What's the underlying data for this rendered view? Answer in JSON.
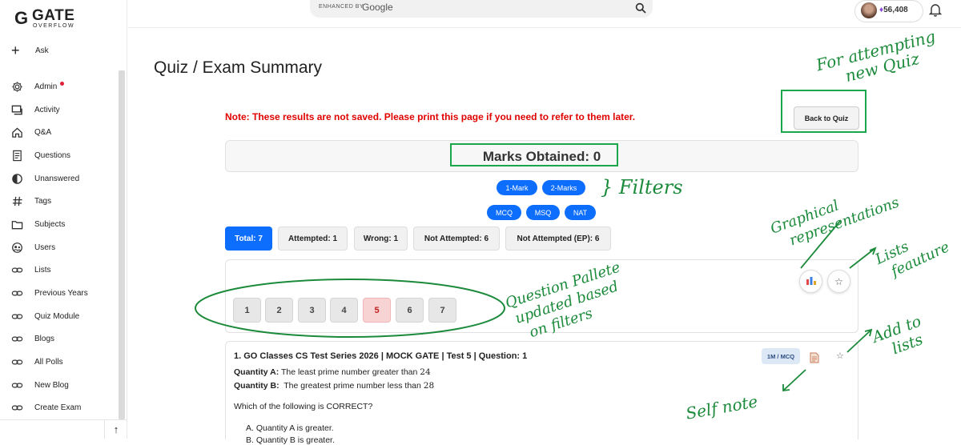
{
  "sidebar": {
    "logo_gate": "GATE",
    "logo_sub": "OVERFLOW",
    "ask_label": "Ask",
    "items": [
      {
        "label": "Admin",
        "icon": "gear-icon"
      },
      {
        "label": "Activity",
        "icon": "chat-icon"
      },
      {
        "label": "Q&A",
        "icon": "home-icon"
      },
      {
        "label": "Questions",
        "icon": "document-icon"
      },
      {
        "label": "Unanswered",
        "icon": "half-circle-icon"
      },
      {
        "label": "Tags",
        "icon": "hash-icon"
      },
      {
        "label": "Subjects",
        "icon": "folder-icon"
      },
      {
        "label": "Users",
        "icon": "users-icon"
      },
      {
        "label": "Lists",
        "icon": "link-icon"
      },
      {
        "label": "Previous Years",
        "icon": "link-icon"
      },
      {
        "label": "Quiz Module",
        "icon": "link-icon"
      },
      {
        "label": "Blogs",
        "icon": "link-icon"
      },
      {
        "label": "All Polls",
        "icon": "link-icon"
      },
      {
        "label": "New Blog",
        "icon": "link-icon"
      },
      {
        "label": "Create Exam",
        "icon": "link-icon"
      }
    ]
  },
  "header": {
    "search_enhanced": "ENHANCED BY",
    "search_google": "Google",
    "points": "56,408"
  },
  "main": {
    "title": "Quiz / Exam Summary",
    "note": "Note: These results are not saved. Please print this page if you need to refer to them later.",
    "back_button": "Back to Quiz",
    "marks": "Marks Obtained: 0",
    "filters_row1": [
      "1-Mark",
      "2-Marks"
    ],
    "filters_row2": [
      "MCQ",
      "MSQ",
      "NAT"
    ],
    "tabs": [
      "Total: 7",
      "Attempted: 1",
      "Wrong: 1",
      "Not Attempted: 6",
      "Not Attempted (EP): 6"
    ],
    "palette": [
      "1",
      "2",
      "3",
      "4",
      "5",
      "6",
      "7"
    ],
    "wrong_question": "5"
  },
  "question": {
    "title": "1. GO Classes CS Test Series 2026 | MOCK GATE | Test 5 | Question: 1",
    "badge": "1M / MCQ",
    "qa_label": "Quantity A:",
    "qa_text": "The least prime number greater than",
    "qa_value": "24",
    "qb_label": "Quantity B:",
    "qb_text": "The greatest prime number less than",
    "qb_value": "28",
    "prompt": "Which of the following is CORRECT?",
    "option_a": "A. Quantity A is greater.",
    "option_b": "B. Quantity B is greater."
  },
  "annotations": {
    "quiz_line1": "For attempting",
    "quiz_line2": "new Quiz",
    "filters": "Filters",
    "graph_line1": "Graphical",
    "graph_line2": "representations",
    "lists_line1": "Lists",
    "lists_line2": "feauture",
    "palette_line1": "Question Pallete",
    "palette_line2": "updated based",
    "palette_line3": "on filters",
    "add_line1": "Add to",
    "add_line2": "lists",
    "self_note": "Self note"
  },
  "colors": {
    "primary": "#0d6efd",
    "note_red": "#e00000",
    "annotation_green": "#1b8a3a"
  }
}
